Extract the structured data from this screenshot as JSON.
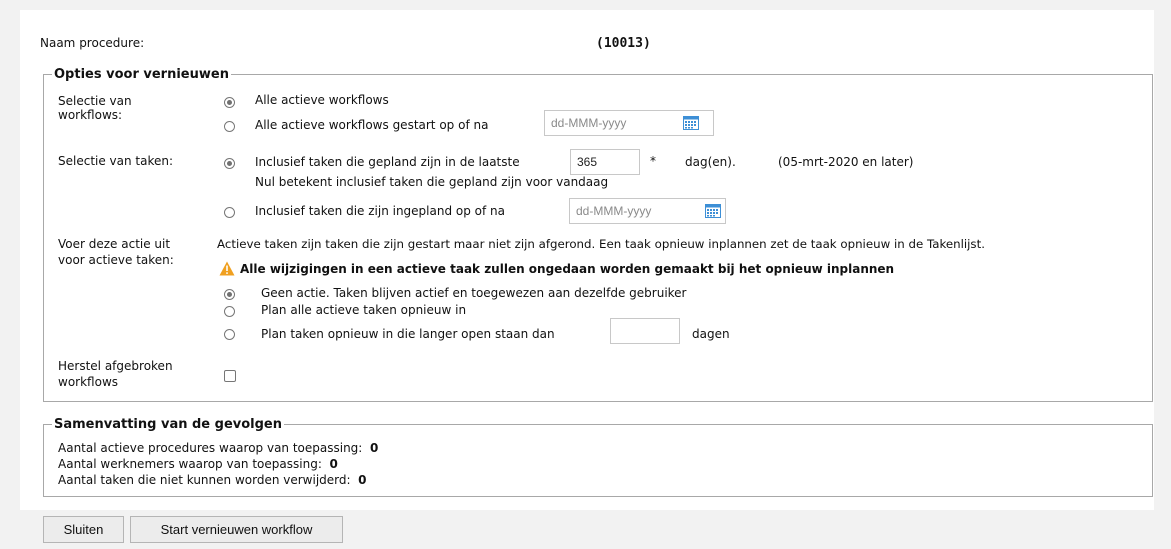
{
  "header": {
    "procedure_label": "Naam procedure:",
    "procedure_value": "(10013)"
  },
  "options": {
    "legend": "Opties voor vernieuwen",
    "workflow_selection": {
      "label_line1": "Selectie van",
      "label_line2": "workflows:",
      "options": [
        "Alle actieve workflows",
        "Alle actieve workflows gestart op of na"
      ],
      "selected": "Alle actieve workflows",
      "date_placeholder": "dd-MMM-yyyy"
    },
    "task_selection": {
      "label": "Selectie van taken:",
      "option1": "Inclusief taken die gepland zijn in de laatste",
      "days_value": "365",
      "required_marker": "*",
      "unit": "dag(en).",
      "date_note": "(05-mrt-2020 en later)",
      "hint": "Nul betekent inclusief taken die gepland zijn voor vandaag",
      "option2": "Inclusief taken die zijn ingepland op of na",
      "date_placeholder": "dd-MMM-yyyy",
      "selected": "option1"
    },
    "active_tasks": {
      "label_line1": "Voer deze actie uit",
      "label_line2": "voor actieve taken:",
      "description": "Actieve taken zijn taken die zijn gestart maar niet zijn afgerond. Een taak opnieuw inplannen zet de taak opnieuw in de Takenlijst.",
      "warning": "Alle wijzigingen in een actieve taak zullen ongedaan worden gemaakt bij het opnieuw inplannen",
      "options": [
        "Geen actie. Taken blijven actief en toegewezen aan dezelfde gebruiker",
        "Plan alle actieve taken opnieuw in",
        "Plan taken opnieuw in die langer open staan dan"
      ],
      "selected_index": 0,
      "days_value": "",
      "days_unit": "dagen"
    },
    "restore": {
      "label_line1": "Herstel afgebroken",
      "label_line2": "workflows",
      "checked": false
    }
  },
  "summary": {
    "legend": "Samenvatting van de gevolgen",
    "rows": [
      {
        "label": "Aantal actieve procedures waarop van toepassing:",
        "value": "0"
      },
      {
        "label": "Aantal werknemers waarop van toepassing:",
        "value": "0"
      },
      {
        "label": "Aantal taken die niet kunnen worden verwijderd:",
        "value": "0"
      }
    ]
  },
  "buttons": {
    "close": "Sluiten",
    "start": "Start vernieuwen workflow"
  },
  "colors": {
    "page_background": "#f2f2f2",
    "panel_background": "#ffffff",
    "border": "#a8a8a8",
    "warning_orange": "#f0a020",
    "calendar_blue": "#3d8fd6"
  },
  "icons": [
    "calendar-icon",
    "warning-icon"
  ]
}
